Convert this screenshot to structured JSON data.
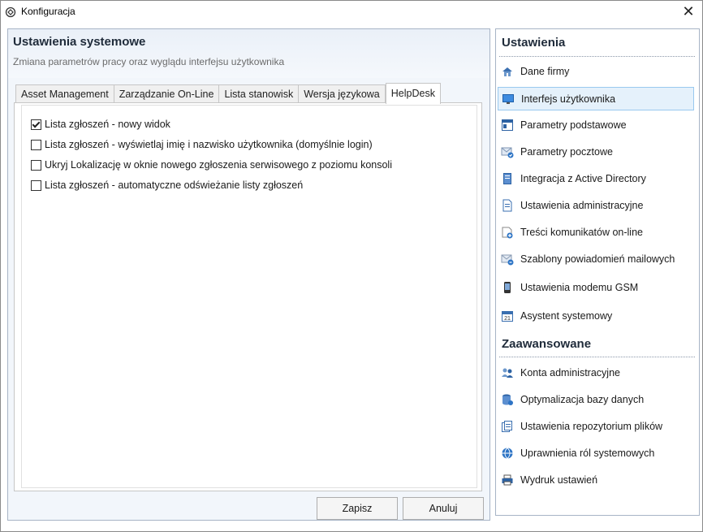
{
  "window": {
    "title": "Konfiguracja",
    "close_glyph": "✕"
  },
  "header": {
    "title": "Ustawienia systemowe",
    "subtitle": "Zmiana parametrów pracy oraz wyglądu interfejsu użytkownika"
  },
  "tabs": [
    {
      "label": "Asset Management",
      "active": false
    },
    {
      "label": "Zarządzanie On-Line",
      "active": false
    },
    {
      "label": "Lista stanowisk",
      "active": false
    },
    {
      "label": "Wersja językowa",
      "active": false
    },
    {
      "label": "HelpDesk",
      "active": true
    }
  ],
  "options": [
    {
      "label": "Lista zgłoszeń - nowy widok",
      "checked": true
    },
    {
      "label": "Lista zgłoszeń - wyświetlaj imię i nazwisko użytkownika (domyślnie login)",
      "checked": false
    },
    {
      "label": "Ukryj Lokalizację w oknie nowego zgłoszenia serwisowego z poziomu konsoli",
      "checked": false
    },
    {
      "label": "Lista zgłoszeń - automatyczne odświeżanie listy zgłoszeń",
      "checked": false
    }
  ],
  "buttons": {
    "save": "Zapisz",
    "cancel": "Anuluj"
  },
  "sidebar": {
    "section1_title": "Ustawienia",
    "section1_items": [
      {
        "label": "Dane firmy",
        "icon": "company-house-icon",
        "selected": false
      },
      {
        "label": "Interfejs użytkownika",
        "icon": "monitor-icon",
        "selected": true
      },
      {
        "label": "Parametry podstawowe",
        "icon": "window-settings-icon",
        "selected": false
      },
      {
        "label": "Parametry pocztowe",
        "icon": "mail-check-icon",
        "selected": false
      },
      {
        "label": "Integracja z Active Directory",
        "icon": "directory-book-icon",
        "selected": false
      },
      {
        "label": "Ustawienia administracyjne",
        "icon": "document-icon",
        "selected": false
      },
      {
        "label": "Treści komunikatów on-line",
        "icon": "message-add-icon",
        "selected": false
      },
      {
        "label": "Szablony powiadomień mailowych",
        "icon": "mail-template-icon",
        "selected": false
      },
      {
        "label": "Ustawienia modemu GSM",
        "icon": "phone-icon",
        "selected": false
      },
      {
        "label": "Asystent systemowy",
        "icon": "calendar-icon",
        "selected": false
      }
    ],
    "section2_title": "Zaawansowane",
    "section2_items": [
      {
        "label": "Konta administracyjne",
        "icon": "users-icon"
      },
      {
        "label": "Optymalizacja bazy danych",
        "icon": "database-icon"
      },
      {
        "label": "Ustawienia repozytorium plików",
        "icon": "file-repository-icon"
      },
      {
        "label": "Uprawnienia ról systemowych",
        "icon": "globe-permissions-icon"
      },
      {
        "label": "Wydruk ustawień",
        "icon": "printer-icon"
      }
    ]
  },
  "colors": {
    "accent": "#1f6fb5",
    "selected_bg": "#e5f1fb",
    "selected_border": "#99c9ef",
    "panel_border": "#a7b4c6"
  }
}
